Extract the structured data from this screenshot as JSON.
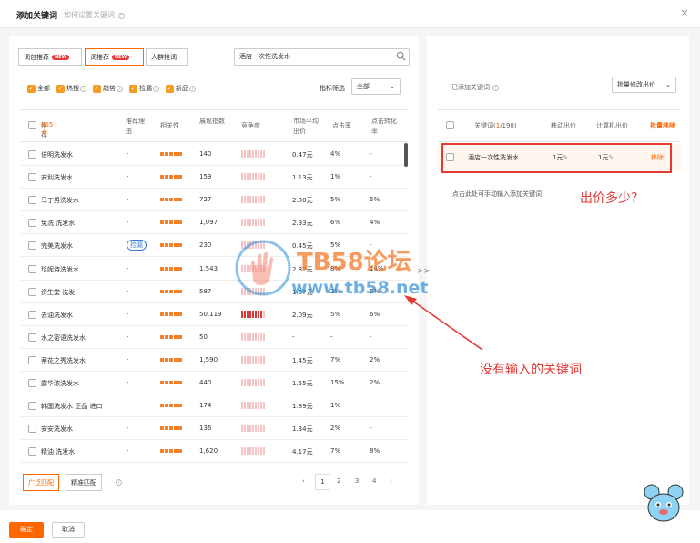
{
  "header": {
    "title": "添加关键词",
    "subtitle": "如何设置关键词",
    "close": "×"
  },
  "tabs": [
    {
      "label": "词包推荐",
      "badge": "NEW"
    },
    {
      "label": "词推荐",
      "badge": "NEW"
    },
    {
      "label": "人群推词",
      "badge": ""
    }
  ],
  "search": {
    "value": "酒店一次性洗发水",
    "icon": "search-icon"
  },
  "filters": [
    {
      "label": "全部",
      "checked": true
    },
    {
      "label": "热搜",
      "checked": true
    },
    {
      "label": "趋势",
      "checked": true
    },
    {
      "label": "捡漏",
      "checked": true
    },
    {
      "label": "新品",
      "checked": true
    }
  ],
  "metric_filter": {
    "label": "指标筛选",
    "value": "全部"
  },
  "table": {
    "headers": {
      "keyword": "推荐",
      "count": "655个",
      "reason": "推荐理由",
      "relevance": "相关性",
      "index": "展现指数",
      "competition": "竞争度",
      "price": "市场平均出价",
      "ctr": "点击率",
      "cvr": "点击转化率"
    },
    "rows": [
      {
        "keyword": "倍明洗发水",
        "reason": "-",
        "index": "140",
        "price": "0.47元",
        "ctr": "4%",
        "cvr": "-"
      },
      {
        "keyword": "安利洗发水",
        "reason": "-",
        "index": "159",
        "price": "1.13元",
        "ctr": "1%",
        "cvr": "-"
      },
      {
        "keyword": "马丁男洗发水",
        "reason": "-",
        "index": "727",
        "price": "2.90元",
        "ctr": "5%",
        "cvr": "5%"
      },
      {
        "keyword": "免洗 洗发水",
        "reason": "-",
        "index": "1,097",
        "price": "2.93元",
        "ctr": "6%",
        "cvr": "4%"
      },
      {
        "keyword": "完美洗发水",
        "reason": "捡漏",
        "index": "230",
        "price": "0.45元",
        "ctr": "5%",
        "cvr": "-"
      },
      {
        "keyword": "珍妮诗洗发水",
        "reason": "-",
        "index": "1,543",
        "price": "2.82元",
        "ctr": "8%",
        "cvr": "14%"
      },
      {
        "keyword": "资生堂 洗发",
        "reason": "-",
        "index": "587",
        "price": "1.57元",
        "ctr": "2%",
        "cvr": "6%"
      },
      {
        "keyword": "去油洗发水",
        "reason": "-",
        "index": "50,119",
        "price": "2.09元",
        "ctr": "5%",
        "cvr": "6%"
      },
      {
        "keyword": "水之密语洗发水",
        "reason": "-",
        "index": "50",
        "price": "-",
        "ctr": "-",
        "cvr": "-"
      },
      {
        "keyword": "蒂花之秀洗发水",
        "reason": "-",
        "index": "1,590",
        "price": "1.45元",
        "ctr": "7%",
        "cvr": "2%"
      },
      {
        "keyword": "露华浓洗发水",
        "reason": "-",
        "index": "440",
        "price": "1.55元",
        "ctr": "15%",
        "cvr": "2%"
      },
      {
        "keyword": "韩国洗发水 正品 进口",
        "reason": "-",
        "index": "174",
        "price": "1.89元",
        "ctr": "1%",
        "cvr": "-"
      },
      {
        "keyword": "安安洗发水",
        "reason": "-",
        "index": "136",
        "price": "1.34元",
        "ctr": "2%",
        "cvr": "-"
      },
      {
        "keyword": "精油 洗发水",
        "reason": "-",
        "index": "1,620",
        "price": "4.17元",
        "ctr": "7%",
        "cvr": "8%"
      }
    ]
  },
  "match": {
    "broad": "广泛匹配",
    "exact": "精准匹配"
  },
  "pagination": {
    "prev": "‹",
    "pages": [
      "1",
      "2",
      "3",
      "4"
    ],
    "next": "›"
  },
  "transfer": ">>",
  "right": {
    "title": "已添加关键词",
    "bulk_button": "批量修改出价",
    "headers": {
      "keyword": "关键词(",
      "count": "1",
      "total": "/198)",
      "mobile": "移动出价",
      "pc": "计算机出价",
      "remove_all": "批量移除"
    },
    "rows": [
      {
        "keyword": "酒店一次性洗发水",
        "mobile": "1元",
        "pc": "1元",
        "remove": "移除"
      }
    ],
    "manual": "点击此处可手动输入添加关键词"
  },
  "annotations": {
    "price_question": "出价多少？",
    "not_input": "没有输入的关键词"
  },
  "watermark": {
    "brand": "TB58论坛",
    "url": "www.tb58.net"
  },
  "footer": {
    "ok": "确定",
    "cancel": "取消"
  },
  "colors": {
    "accent": "#ff6600",
    "annotation_red": "#e53935",
    "bar_orange": "#f5822a"
  }
}
